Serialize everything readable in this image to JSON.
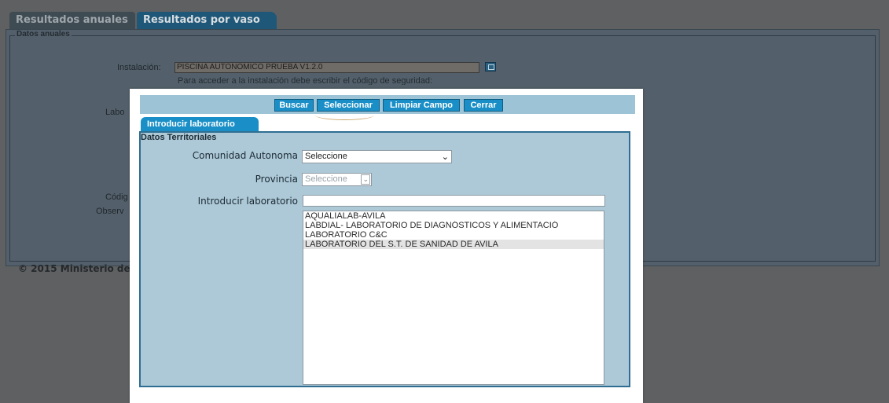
{
  "tabs": [
    "Resultados anuales",
    "Resultados por vaso"
  ],
  "background": {
    "fieldset_legend": "Datos anuales",
    "instalacion_label": "Instalación:",
    "instalacion_value": "PISCINA AUTONOMICO PRUEBA V1.2.0",
    "help_text": "Para acceder a la instalación debe escribir el código de seguridad:",
    "lab_label_partial": "Labo",
    "codigo_label_partial": "Códig",
    "observ_label_partial": "Observ",
    "footer": "© 2015 Ministerio de"
  },
  "modal": {
    "buttons": {
      "buscar": "Buscar",
      "seleccionar": "Seleccionar",
      "limpiar": "Limpiar Campo",
      "cerrar": "Cerrar"
    },
    "tab_label": "Introducir laboratorio",
    "section_title": "Datos Territoriales",
    "comunidad_label": "Comunidad Autonoma",
    "comunidad_value": "Seleccione",
    "provincia_label": "Provincia",
    "provincia_value": "Seleccione",
    "lab_input_label": "Introducir laboratorio",
    "lab_input_value": "",
    "lab_options": [
      "AQUALIALAB-AVILA",
      "LABDIAL- LABORATORIO DE DIAGNÓSTICOS Y ALIMENTACIÓ",
      "LABORATORIO C&C",
      "LABORATORIO DEL S.T. DE SANIDAD DE AVILA"
    ],
    "selected_option_index": 3
  },
  "icons": {
    "lookup": "search-lookup-icon",
    "dropdown": "chevron-down-icon"
  }
}
